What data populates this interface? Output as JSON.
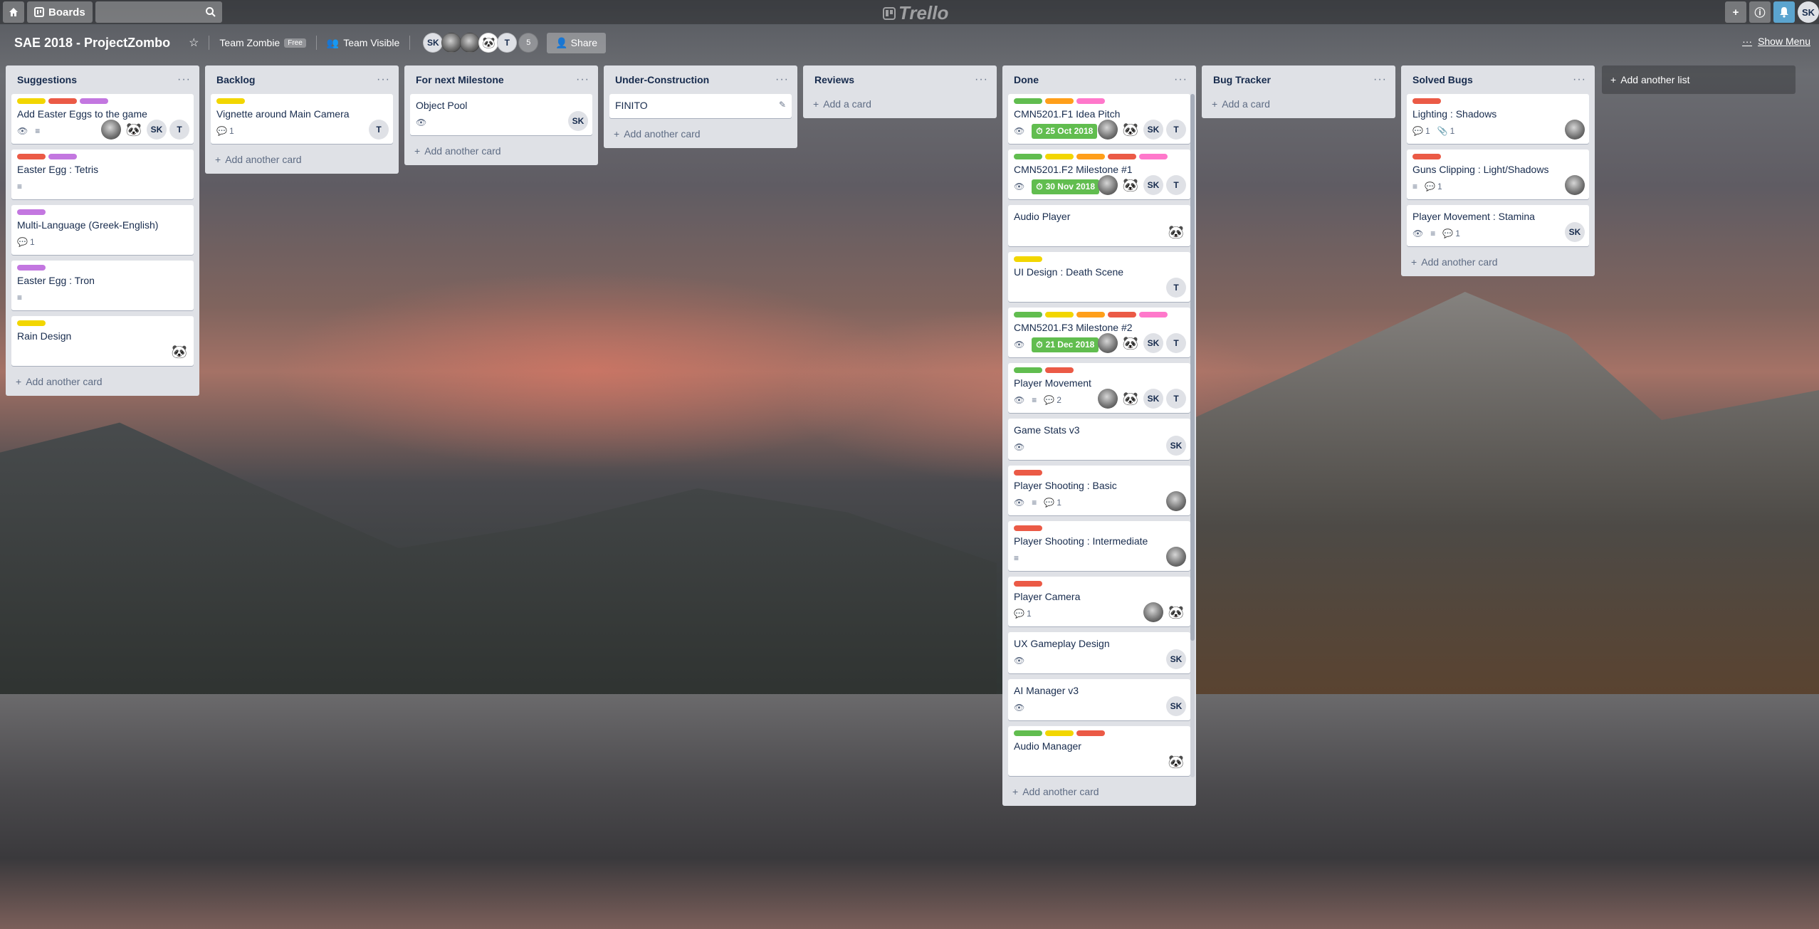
{
  "colors": {
    "green": "#61bd4f",
    "yellow": "#f2d600",
    "orange": "#ff9f1a",
    "red": "#eb5a46",
    "purple": "#c377e0",
    "pink": "#ff78cb"
  },
  "topbar": {
    "home_icon": "home-icon",
    "boards_label": "Boards",
    "search_placeholder": "",
    "logo_text": "Trello",
    "user_initials": "SK"
  },
  "board": {
    "title": "SAE 2018 - ProjectZombo",
    "team_name": "Team Zombie",
    "team_plan": "Free",
    "visibility": "Team Visible",
    "members": [
      {
        "initials": "SK",
        "kind": "initials"
      },
      {
        "initials": "",
        "kind": "photo"
      },
      {
        "initials": "",
        "kind": "photo"
      },
      {
        "initials": "",
        "kind": "panda"
      },
      {
        "initials": "T",
        "kind": "initials"
      }
    ],
    "member_count": "5",
    "share_label": "Share",
    "show_menu": "Show Menu"
  },
  "lists": [
    {
      "title": "Suggestions",
      "add": "Add another card",
      "cards": [
        {
          "labels": [
            "yellow",
            "red",
            "purple"
          ],
          "title": "Add Easter Eggs to the game",
          "badges": {
            "watch": true,
            "desc": true
          },
          "members": [
            "photo",
            "panda",
            "SK",
            "T"
          ]
        },
        {
          "labels": [
            "red",
            "purple"
          ],
          "title": "Easter Egg : Tetris",
          "badges": {
            "desc": true
          },
          "members": []
        },
        {
          "labels": [
            "purple"
          ],
          "title": "Multi-Language (Greek-English)",
          "badges": {
            "comments": "1"
          },
          "members": []
        },
        {
          "labels": [
            "purple"
          ],
          "title": "Easter Egg : Tron",
          "badges": {
            "desc": true
          },
          "members": []
        },
        {
          "labels": [
            "yellow"
          ],
          "title": "Rain Design",
          "badges": {},
          "members": [
            "panda"
          ]
        }
      ]
    },
    {
      "title": "Backlog",
      "add": "Add another card",
      "cards": [
        {
          "labels": [
            "yellow"
          ],
          "title": "Vignette around Main Camera",
          "badges": {
            "comments": "1"
          },
          "members": [
            "T"
          ]
        }
      ]
    },
    {
      "title": "For next Milestone",
      "add": "Add another card",
      "cards": [
        {
          "labels": [],
          "title": "Object Pool",
          "badges": {
            "watch": true
          },
          "members": [
            "SK"
          ]
        }
      ]
    },
    {
      "title": "Under-Construction",
      "add": "Add another card",
      "cards": [
        {
          "labels": [],
          "title": "FINITO",
          "badges": {},
          "members": [],
          "edit": true
        }
      ]
    },
    {
      "title": "Reviews",
      "add": "Add a card",
      "cards": []
    },
    {
      "title": "Done",
      "add": "Add another card",
      "cards": [
        {
          "labels": [
            "green",
            "orange",
            "pink"
          ],
          "title": "CMN5201.F1 Idea Pitch",
          "badges": {
            "watch": true,
            "due": "25 Oct 2018",
            "desc": true
          },
          "members": [
            "photo",
            "panda",
            "SK",
            "T"
          ]
        },
        {
          "labels": [
            "green",
            "yellow",
            "orange",
            "red",
            "pink"
          ],
          "title": "CMN5201.F2 Milestone #1",
          "badges": {
            "watch": true,
            "due": "30 Nov 2018",
            "desc": true
          },
          "members": [
            "photo",
            "panda",
            "SK",
            "T"
          ]
        },
        {
          "labels": [],
          "title": "Audio Player",
          "badges": {},
          "members": [
            "panda"
          ]
        },
        {
          "labels": [
            "yellow"
          ],
          "title": "UI Design : Death Scene",
          "badges": {},
          "members": [
            "T"
          ]
        },
        {
          "labels": [
            "green",
            "yellow",
            "orange",
            "red",
            "pink"
          ],
          "title": "CMN5201.F3 Milestone #2",
          "badges": {
            "watch": true,
            "due": "21 Dec 2018",
            "desc": true
          },
          "members": [
            "photo",
            "panda",
            "SK",
            "T"
          ]
        },
        {
          "labels": [
            "green",
            "red"
          ],
          "title": "Player Movement",
          "badges": {
            "watch": true,
            "desc": true,
            "comments": "2"
          },
          "members": [
            "photo",
            "panda",
            "SK",
            "T"
          ]
        },
        {
          "labels": [],
          "title": "Game Stats v3",
          "badges": {
            "watch": true
          },
          "members": [
            "SK"
          ]
        },
        {
          "labels": [
            "red"
          ],
          "title": "Player Shooting : Basic",
          "badges": {
            "watch": true,
            "desc": true,
            "comments": "1"
          },
          "members": [
            "photo"
          ]
        },
        {
          "labels": [
            "red"
          ],
          "title": "Player Shooting : Intermediate",
          "badges": {
            "desc": true
          },
          "members": [
            "photo"
          ]
        },
        {
          "labels": [
            "red"
          ],
          "title": "Player Camera",
          "badges": {
            "comments": "1"
          },
          "members": [
            "photo",
            "panda"
          ]
        },
        {
          "labels": [],
          "title": "UX Gameplay Design",
          "badges": {
            "watch": true
          },
          "members": [
            "SK"
          ]
        },
        {
          "labels": [],
          "title": "AI Manager v3",
          "badges": {
            "watch": true
          },
          "members": [
            "SK"
          ]
        },
        {
          "labels": [
            "green",
            "yellow",
            "red"
          ],
          "title": "Audio Manager",
          "badges": {},
          "members": [
            "panda"
          ]
        }
      ]
    },
    {
      "title": "Bug Tracker",
      "add": "Add a card",
      "cards": []
    },
    {
      "title": "Solved Bugs",
      "add": "Add another card",
      "cards": [
        {
          "labels": [
            "red"
          ],
          "title": "Lighting : Shadows",
          "badges": {
            "comments": "1",
            "attachments": "1"
          },
          "members": [
            "photo"
          ]
        },
        {
          "labels": [
            "red"
          ],
          "title": "Guns Clipping : Light/Shadows",
          "badges": {
            "desc": true,
            "comments": "1"
          },
          "members": [
            "photo"
          ]
        },
        {
          "labels": [],
          "title": "Player Movement : Stamina",
          "badges": {
            "watch": true,
            "desc": true,
            "comments": "1"
          },
          "members": [
            "SK"
          ]
        }
      ]
    }
  ],
  "add_list_label": "Add another list"
}
